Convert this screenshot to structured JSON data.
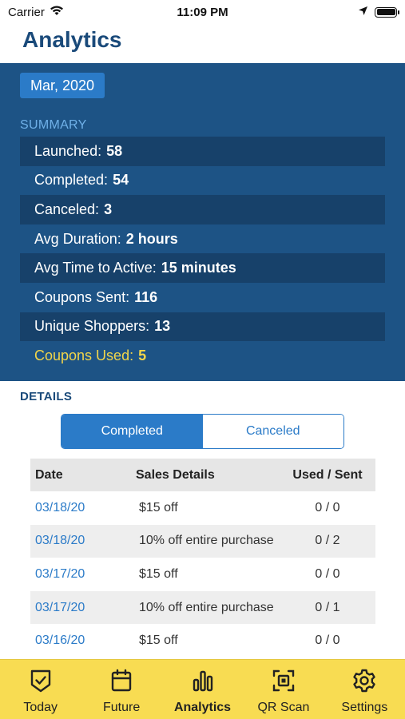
{
  "status_bar": {
    "carrier": "Carrier",
    "time": "11:09 PM"
  },
  "header": {
    "title": "Analytics"
  },
  "summary": {
    "date": "Mar, 2020",
    "heading": "SUMMARY",
    "items": [
      {
        "label": "Launched:",
        "value": "58"
      },
      {
        "label": "Completed:",
        "value": "54"
      },
      {
        "label": "Canceled:",
        "value": "3"
      },
      {
        "label": "Avg Duration:",
        "value": "2 hours"
      },
      {
        "label": "Avg Time to Active:",
        "value": "15 minutes"
      },
      {
        "label": "Coupons Sent:",
        "value": "116"
      },
      {
        "label": "Unique Shoppers:",
        "value": "13"
      },
      {
        "label": "Coupons Used:",
        "value": "5"
      }
    ]
  },
  "details": {
    "heading": "DETAILS",
    "segments": [
      "Completed",
      "Canceled"
    ],
    "columns": [
      "Date",
      "Sales Details",
      "Used / Sent"
    ],
    "rows": [
      {
        "date": "03/18/20",
        "sales": "$15 off",
        "used": "0 / 0"
      },
      {
        "date": "03/18/20",
        "sales": "10% off entire purchase",
        "used": "0 / 2"
      },
      {
        "date": "03/17/20",
        "sales": "$15 off",
        "used": "0 / 0"
      },
      {
        "date": "03/17/20",
        "sales": "10% off entire purchase",
        "used": "0 / 1"
      },
      {
        "date": "03/16/20",
        "sales": "$15 off",
        "used": "0 / 0"
      }
    ]
  },
  "tab_bar": {
    "tabs": [
      {
        "label": "Today",
        "icon": "shield-check-icon"
      },
      {
        "label": "Future",
        "icon": "calendar-icon"
      },
      {
        "label": "Analytics",
        "icon": "bar-chart-icon"
      },
      {
        "label": "QR Scan",
        "icon": "qr-scan-icon"
      },
      {
        "label": "Settings",
        "icon": "gear-icon"
      }
    ]
  },
  "colors": {
    "accent": "#2b7bc8",
    "panel": "#1d5385",
    "highlight": "#f1d54a",
    "tab_bar": "#f8dc52"
  }
}
